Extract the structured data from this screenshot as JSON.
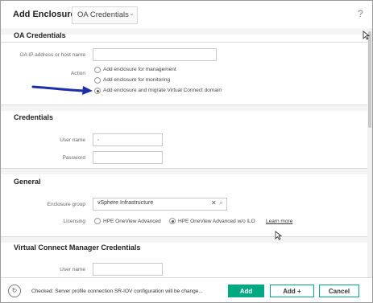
{
  "header": {
    "title": "Add Enclosure",
    "view_select": "OA Credentials",
    "help": "?"
  },
  "oa_credentials": {
    "section_title": "OA Credentials",
    "ip_label": "OA IP address or host name",
    "ip_value": "",
    "action_label": "Action",
    "actions": [
      {
        "label": "Add enclosure for management",
        "selected": false
      },
      {
        "label": "Add enclosure for monitoring",
        "selected": false
      },
      {
        "label": "Add enclosure and migrate Virtual Connect domain",
        "selected": true
      }
    ]
  },
  "credentials": {
    "section_title": "Credentials",
    "username_label": "User name",
    "username_value": ",",
    "password_label": "Password",
    "password_value": ""
  },
  "general": {
    "section_title": "General",
    "enclosure_group_label": "Enclosure group",
    "enclosure_group_value": "vSphere Infrastructure",
    "clear": "✕",
    "licensing_label": "Licensing",
    "licensing_options": [
      {
        "label": "HPE OneView Advanced",
        "selected": false
      },
      {
        "label": "HPE OneView Advanced w/o iLO",
        "selected": true
      }
    ],
    "learn_more": "Learn more"
  },
  "vc_manager": {
    "section_title": "Virtual Connect Manager Credentials",
    "username_label": "User name",
    "username_value": ""
  },
  "footer": {
    "status_text": "Checked: Server profile connection SR-IOV configuration will be change...",
    "add_label": "Add",
    "add_plus_label": "Add +",
    "cancel_label": "Cancel"
  },
  "colors": {
    "accent": "#01a982",
    "annotation_arrow": "#1a2fa8"
  }
}
